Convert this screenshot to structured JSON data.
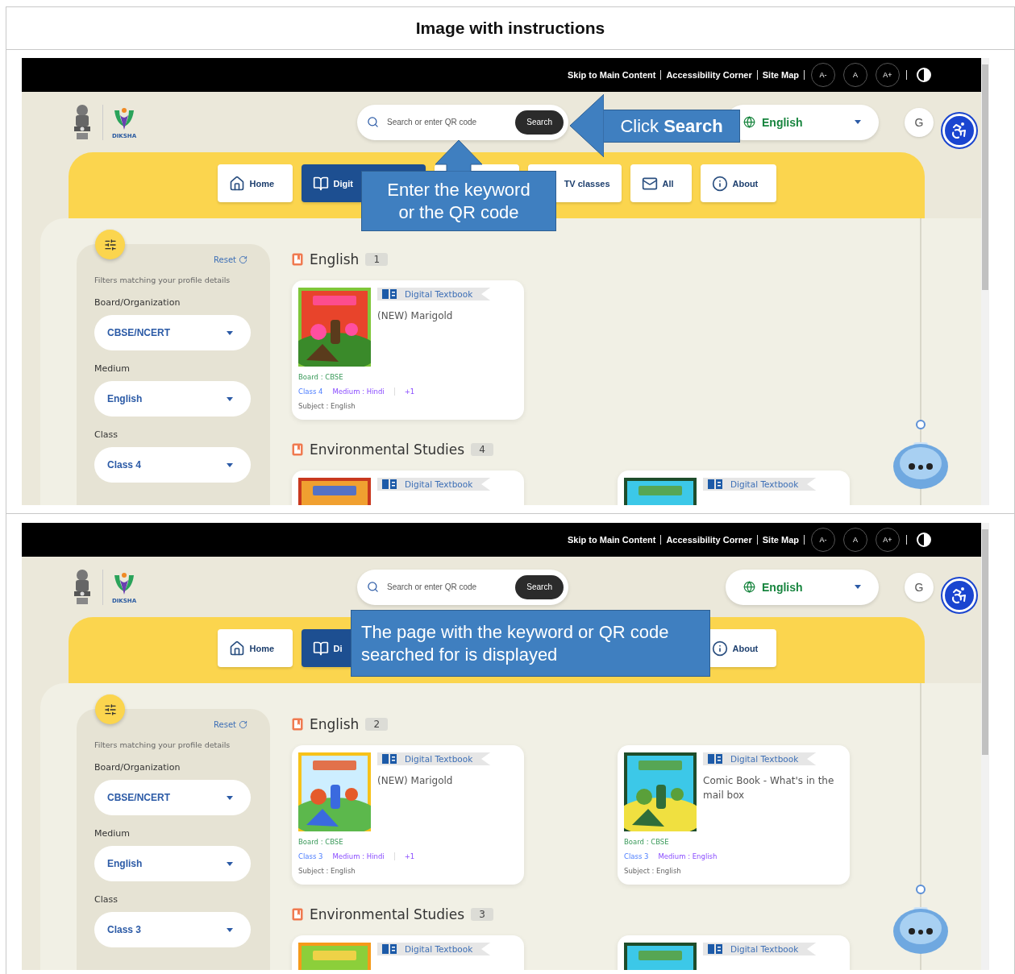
{
  "caption": "Image with instructions",
  "screens": [
    {
      "top_links": [
        "Skip to Main Content",
        "Accessibility Corner",
        "Site Map"
      ],
      "font_buttons": [
        "A-",
        "A",
        "A+"
      ],
      "brand": "DIKSHA",
      "search": {
        "placeholder": "Search or enter QR code",
        "button": "Search"
      },
      "language": {
        "value": "English"
      },
      "profile_initial": "G",
      "nav": [
        {
          "kind": "tab",
          "label": "Home",
          "selected": false
        },
        {
          "kind": "tab",
          "label": "Digit",
          "selected": true
        },
        {
          "kind": "tab",
          "selected": false
        },
        {
          "kind": "tab",
          "label": "TV classes",
          "selected": false
        },
        {
          "kind": "tab",
          "label": "All",
          "selected": false
        },
        {
          "kind": "tab",
          "label": "About",
          "selected": false
        }
      ],
      "filters": {
        "reset": "Reset",
        "hint": "Filters matching your profile details",
        "fields": [
          {
            "label": "Board/Organization",
            "value": "CBSE/NCERT"
          },
          {
            "label": "Medium",
            "value": "English"
          },
          {
            "label": "Class",
            "value": "Class 4"
          }
        ]
      },
      "sections": [
        {
          "title": "English",
          "count": "1",
          "cards": [
            {
              "tag": "Digital Textbook",
              "title": "(NEW) Marigold",
              "board": "Board : CBSE",
              "class": "Class 4",
              "medium": "Medium : Hindi",
              "extra": "+1",
              "subject": "Subject : English"
            }
          ]
        },
        {
          "title": "Environmental Studies",
          "count": "4",
          "cards": [
            {
              "tag": "Digital Textbook"
            },
            {
              "tag": "Digital Textbook"
            }
          ]
        }
      ],
      "callouts": [
        {
          "kind": "arrow-left",
          "text": "Click **Search**"
        },
        {
          "kind": "arrow-up",
          "text": "Enter the keyword\nor the QR code"
        }
      ]
    },
    {
      "top_links": [
        "Skip to Main Content",
        "Accessibility Corner",
        "Site Map"
      ],
      "font_buttons": [
        "A-",
        "A",
        "A+"
      ],
      "brand": "DIKSHA",
      "search": {
        "placeholder": "Search or enter QR code",
        "button": "Search"
      },
      "language": {
        "value": "English"
      },
      "profile_initial": "G",
      "nav": [
        {
          "kind": "tab",
          "label": "Home",
          "selected": false
        },
        {
          "kind": "tab",
          "label": "Di",
          "selected": true
        },
        {
          "kind": "covered"
        },
        {
          "kind": "covered"
        },
        {
          "kind": "covered"
        },
        {
          "kind": "tab",
          "label": "About",
          "selected": false
        }
      ],
      "filters": {
        "reset": "Reset",
        "hint": "Filters matching your profile details",
        "fields": [
          {
            "label": "Board/Organization",
            "value": "CBSE/NCERT"
          },
          {
            "label": "Medium",
            "value": "English"
          },
          {
            "label": "Class",
            "value": "Class 3"
          }
        ]
      },
      "sections": [
        {
          "title": "English",
          "count": "2",
          "cards": [
            {
              "tag": "Digital Textbook",
              "title": "(NEW) Marigold",
              "board": "Board : CBSE",
              "class": "Class 3",
              "medium": "Medium : Hindi",
              "extra": "+1",
              "subject": "Subject : English"
            },
            {
              "tag": "Digital Textbook",
              "title": "Comic Book - What's in the mail box",
              "board": "Board : CBSE",
              "class": "Class 3",
              "medium": "Medium : English",
              "subject": "Subject : English"
            }
          ]
        },
        {
          "title": "Environmental Studies",
          "count": "3",
          "cards": [
            {
              "tag": "Digital Textbook"
            },
            {
              "tag": "Digital Textbook"
            }
          ]
        }
      ],
      "callouts": [
        {
          "kind": "plain",
          "text": "The page with the keyword or QR code\nsearched for is displayed"
        }
      ]
    }
  ]
}
